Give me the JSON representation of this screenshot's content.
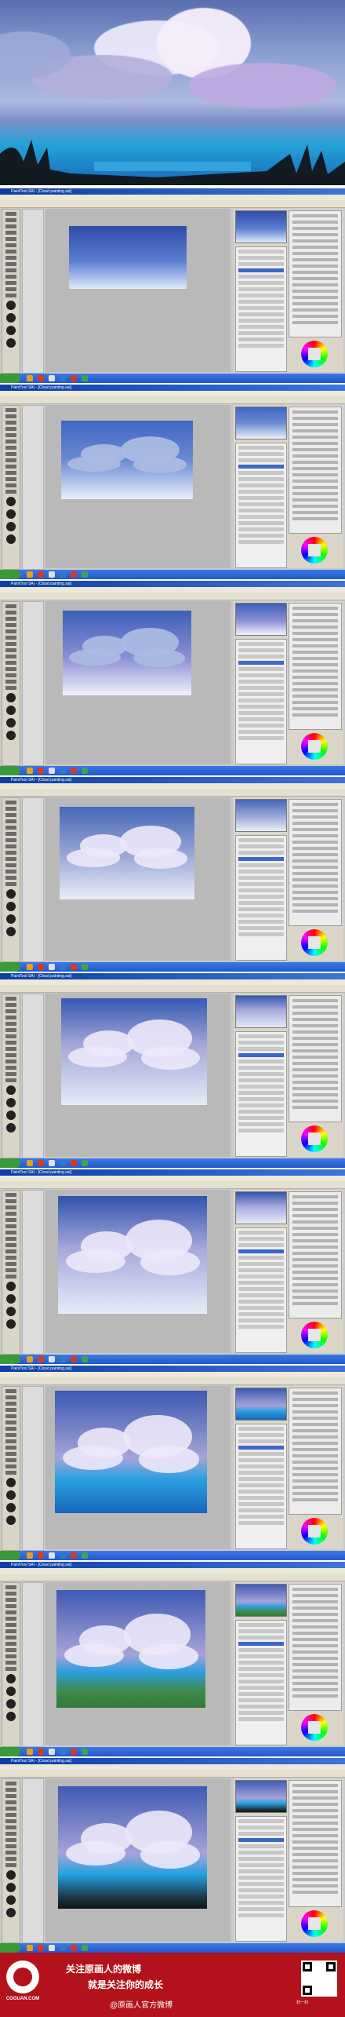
{
  "app": {
    "window_title": "PaintTool SAI - [Cloud painting.sai]",
    "menu": [
      "File",
      "Edit",
      "Canvas",
      "Layer",
      "Selection",
      "Filter",
      "View",
      "Window",
      "Others"
    ]
  },
  "steps": [
    {
      "id": 1,
      "canvas": "sky-gradient"
    },
    {
      "id": 2,
      "canvas": "cloud-blocks"
    },
    {
      "id": 3,
      "canvas": "cloud-light"
    },
    {
      "id": 4,
      "canvas": "cloud-volume"
    },
    {
      "id": 5,
      "canvas": "cloud-large"
    },
    {
      "id": 6,
      "canvas": "cloud-mirrored"
    },
    {
      "id": 7,
      "canvas": "lake-water"
    },
    {
      "id": 8,
      "canvas": "green-ground"
    },
    {
      "id": 9,
      "canvas": "final-grass"
    }
  ],
  "footer": {
    "logo_text": "COGUAN.COM",
    "slogan_line1": "关注原画人的微博",
    "slogan_line2": "就是关注你的成长",
    "weibo": "@原画人官方微博",
    "qr_caption": "扫一扫"
  },
  "colors": {
    "sky": "#6f86c9",
    "water": "#1f8fd4",
    "footer": "#b3111b"
  }
}
